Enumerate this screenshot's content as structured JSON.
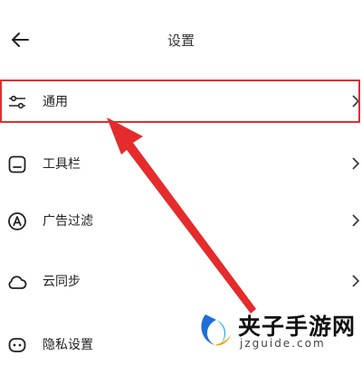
{
  "header": {
    "title": "设置"
  },
  "menu": {
    "items": [
      {
        "label": "通用"
      },
      {
        "label": "工具栏"
      },
      {
        "label": "广告过滤"
      },
      {
        "label": "云同步"
      },
      {
        "label": "隐私设置"
      }
    ]
  },
  "watermark": {
    "title": "夹子手游网",
    "subtitle": "jzguide.com"
  },
  "colors": {
    "highlight": "#e03030",
    "text": "#222222"
  }
}
